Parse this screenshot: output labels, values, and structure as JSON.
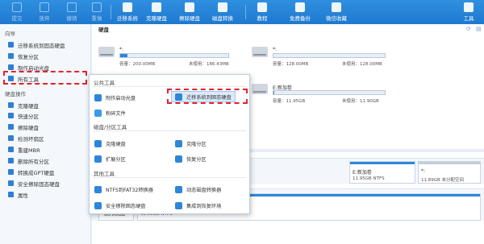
{
  "toolbar": {
    "items": [
      {
        "label": "提交",
        "icon": "submit-icon",
        "enabled": false
      },
      {
        "label": "放弃",
        "icon": "discard-icon",
        "enabled": false
      },
      {
        "label": "撤销",
        "icon": "undo-icon",
        "enabled": false
      },
      {
        "label": "重做",
        "icon": "redo-icon",
        "enabled": false
      },
      {
        "label": "迁移系统",
        "icon": "migrate-os-icon",
        "enabled": true
      },
      {
        "label": "克隆硬盘",
        "icon": "clone-disk-icon",
        "enabled": true
      },
      {
        "label": "擦除硬盘",
        "icon": "wipe-disk-icon",
        "enabled": true
      },
      {
        "label": "磁盘转换",
        "icon": "disk-convert-icon",
        "enabled": true
      },
      {
        "label": "教程",
        "icon": "tutorial-icon",
        "enabled": true
      },
      {
        "label": "免费备份",
        "icon": "free-backup-icon",
        "enabled": true
      },
      {
        "label": "微信收藏",
        "icon": "wechat-icon",
        "enabled": true
      },
      {
        "label": "工具",
        "icon": "tools-icon",
        "enabled": true
      }
    ]
  },
  "sidebar": {
    "wizard_heading": "向导",
    "wizard_items": [
      {
        "label": "迁移系统到固态硬盘",
        "icon": "migrate-icon"
      },
      {
        "label": "恢复分区",
        "icon": "recover-partition-icon"
      },
      {
        "label": "制作启动光盘",
        "icon": "bootable-media-icon"
      },
      {
        "label": "所有工具",
        "icon": "all-tools-icon"
      }
    ],
    "disk_heading": "硬盘操作",
    "disk_items": [
      {
        "label": "克隆硬盘",
        "icon": "clone-icon"
      },
      {
        "label": "快速分区",
        "icon": "quick-partition-icon"
      },
      {
        "label": "擦除硬盘",
        "icon": "wipe-icon"
      },
      {
        "label": "检测坏扇区",
        "icon": "bad-sector-icon"
      },
      {
        "label": "重建MBR",
        "icon": "rebuild-mbr-icon"
      },
      {
        "label": "删除所有分区",
        "icon": "delete-all-icon"
      },
      {
        "label": "转换成GPT硬盘",
        "icon": "convert-gpt-icon"
      },
      {
        "label": "安全擦除固态硬盘",
        "icon": "secure-erase-icon"
      },
      {
        "label": "属性",
        "icon": "properties-icon"
      }
    ]
  },
  "main": {
    "disk_label": "硬盘",
    "partitions": [
      {
        "name": "*:",
        "total": "容量：200.00MB",
        "free": "未使用：186.43MB",
        "fill": 0.07
      },
      {
        "name": "*:",
        "total": "容量：128.00MB",
        "free": "未使用：128.00MB",
        "fill": 0.0
      },
      {
        "name": "E:新加卷",
        "total": "容量：11.95GB",
        "free": "未使用：11.90GB",
        "fill": 0.01
      }
    ],
    "lower_segments": [
      {
        "t1": "E:新加卷",
        "t2": "11.95GB NTFS"
      },
      {
        "t1": "*:",
        "t2": "11.89GB 未分配空间"
      }
    ],
    "disk_size": "60.00GB",
    "disk_size_2": "60.00GB NTFS"
  },
  "popup": {
    "public_heading": "公共工具",
    "public_items": [
      {
        "label": "制作启动光盘",
        "icon": "bootable-media-icon"
      },
      {
        "label": "迁移系统到固态硬盘",
        "icon": "migrate-icon"
      },
      {
        "label": "粉碎文件",
        "icon": "shred-file-icon"
      }
    ],
    "disk_heading": "磁盘/分区工具",
    "disk_items": [
      {
        "label": "克隆硬盘",
        "icon": "clone-icon"
      },
      {
        "label": "克隆分区",
        "icon": "clone-partition-icon"
      },
      {
        "label": "扩展分区",
        "icon": "extend-partition-icon"
      },
      {
        "label": "恢复分区",
        "icon": "recover-partition-icon"
      }
    ],
    "other_heading": "其他工具",
    "other_items": [
      {
        "label": "NTFS到FAT32转换器",
        "icon": "ntfs-fat32-icon"
      },
      {
        "label": "动态磁盘转换器",
        "icon": "dynamic-disk-icon"
      },
      {
        "label": "安全擦除固态硬盘",
        "icon": "secure-erase-icon"
      },
      {
        "label": "集成到恢复环境",
        "icon": "recovery-env-icon"
      }
    ]
  },
  "colors": {
    "toolbar": "#2f8fe0",
    "highlight": "#e3232a",
    "accent": "#2f86d8"
  }
}
